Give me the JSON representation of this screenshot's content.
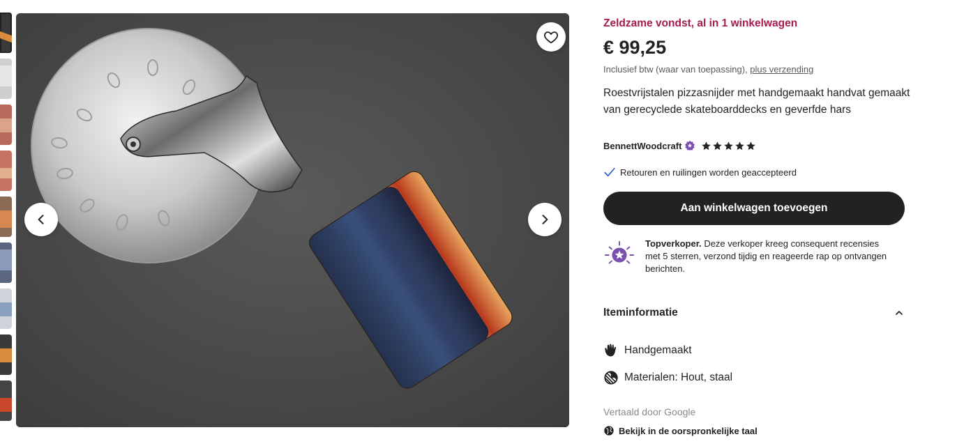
{
  "listing": {
    "rare_find": "Zeldzame vondst, al in 1 winkelwagen",
    "price": "€ 99,25",
    "vat_text": "Inclusief btw (waar van toepassing),",
    "shipping_link": "plus verzending",
    "description": "Roestvrijstalen pizzasnijder met handgemaakt handvat gemaakt van gerecyclede skateboarddecks en geverfde hars",
    "seller_name": "BennettWoodcraft",
    "rating_stars": 5,
    "returns_text": "Retouren en ruilingen worden geaccepteerd",
    "cart_button": "Aan winkelwagen toevoegen",
    "top_seller_label": "Topverkoper.",
    "top_seller_text": "Deze verkoper kreeg consequent recensies met 5 sterren, verzond tijdig en reageerde rap op ontvangen berichten."
  },
  "item_info": {
    "title": "Iteminformatie",
    "features": [
      {
        "icon": "hand-icon",
        "label": "Handgemaakt"
      },
      {
        "icon": "materials-icon",
        "label": "Materialen: Hout, staal"
      }
    ],
    "translated_by": "Vertaald door Google",
    "view_original": "Bekijk in de oorspronkelijke taal"
  },
  "gallery": {
    "thumbnail_count": 9,
    "active_index": 0
  },
  "colors": {
    "accent_rare": "#a61a4f",
    "button_dark": "#222222",
    "top_seller_purple": "#7b4fb0",
    "check_blue": "#2a5ac7"
  }
}
